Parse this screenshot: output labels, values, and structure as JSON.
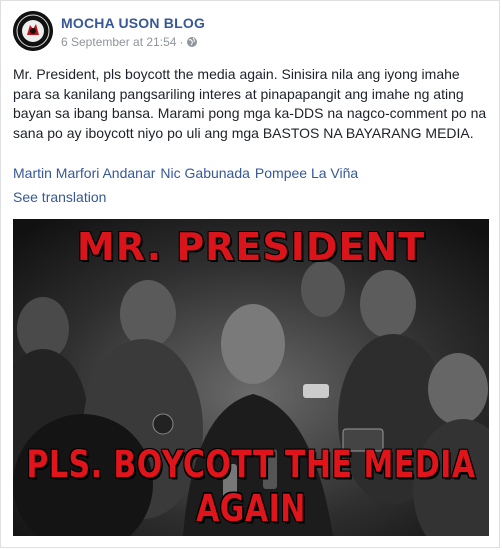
{
  "post": {
    "page_name": "MOCHA USON BLOG",
    "timestamp": "6 September at 21:54",
    "separator": "·",
    "privacy_icon": "globe-icon",
    "body": "Mr. President, pls boycott the media again. Sinisira nila ang iyong imahe para sa kanilang pangsariling interes at pinapapangit ang imahe ng ating bayan sa ibang bansa. Marami pong mga ka-DDS na nagco-comment po na sana po ay iboycott niyo po uli ang mga BASTOS NA BAYARANG MEDIA.",
    "tags": [
      "Martin Marfori Andanar",
      "Nic Gabunada",
      "Pompee La Viña"
    ],
    "see_translation": "See translation"
  },
  "photo": {
    "caption_top": "MR. PRESIDENT",
    "caption_bottom": "PLS. BOYCOTT THE MEDIA AGAIN",
    "caption_color": "#d9141b"
  },
  "colors": {
    "link": "#365899",
    "text": "#1d2129",
    "meta": "#90949c"
  }
}
